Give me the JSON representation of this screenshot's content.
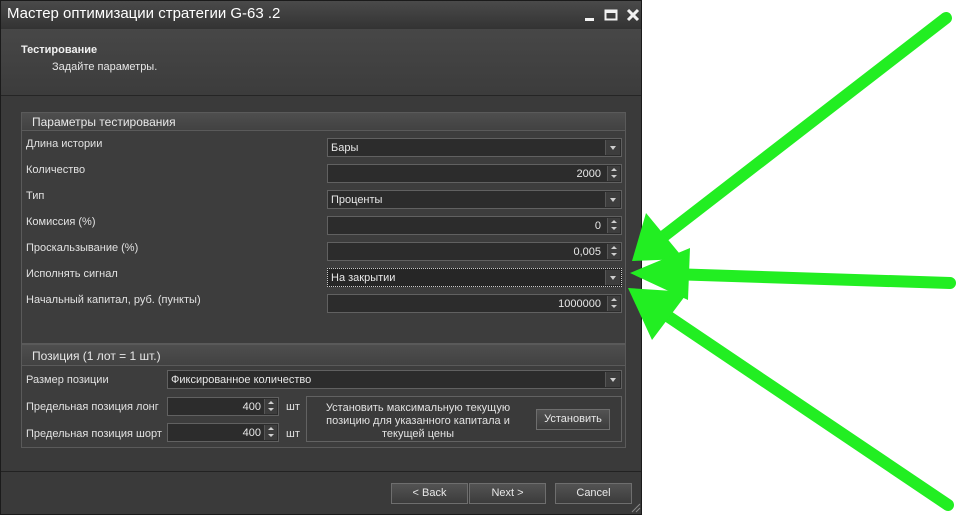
{
  "window": {
    "title": "Мастер оптимизации стратегии G-63 .2"
  },
  "header": {
    "title": "Тестирование",
    "subtitle": "Задайте параметры."
  },
  "test_params": {
    "title": "Параметры тестирования",
    "history_length": {
      "label": "Длина истории",
      "value": "Бары"
    },
    "count": {
      "label": "Количество",
      "value": "2000"
    },
    "type": {
      "label": "Тип",
      "value": "Проценты"
    },
    "commission": {
      "label": "Комиссия (%)",
      "value": "0"
    },
    "slippage": {
      "label": "Проскальзывание (%)",
      "value": "0,005"
    },
    "execute_signal": {
      "label": "Исполнять сигнал",
      "value": "На закрытии"
    },
    "initial_capital": {
      "label": "Начальный капитал, руб. (пункты)",
      "value": "1000000"
    }
  },
  "position": {
    "title": "Позиция (1 лот = 1 шт.)",
    "size": {
      "label": "Размер позиции",
      "value": "Фиксированное количество"
    },
    "long_limit": {
      "label": "Предельная позиция лонг",
      "value": "400",
      "unit": "шт"
    },
    "short_limit": {
      "label": "Предельная позиция шорт",
      "value": "400",
      "unit": "шт"
    },
    "info_text": "Установить максимальную текущую позицию для указанного капитала и текущей цены",
    "set_button": "Установить"
  },
  "footer": {
    "back": "< Back",
    "next": "Next >",
    "cancel": "Cancel"
  },
  "colors": {
    "arrow": "#22ee22",
    "background": "#3a3a3a"
  },
  "icons": [
    "minimize-icon",
    "maximize-icon",
    "close-icon",
    "dropdown-arrow-icon",
    "spinner-icon",
    "resize-grip-icon"
  ]
}
